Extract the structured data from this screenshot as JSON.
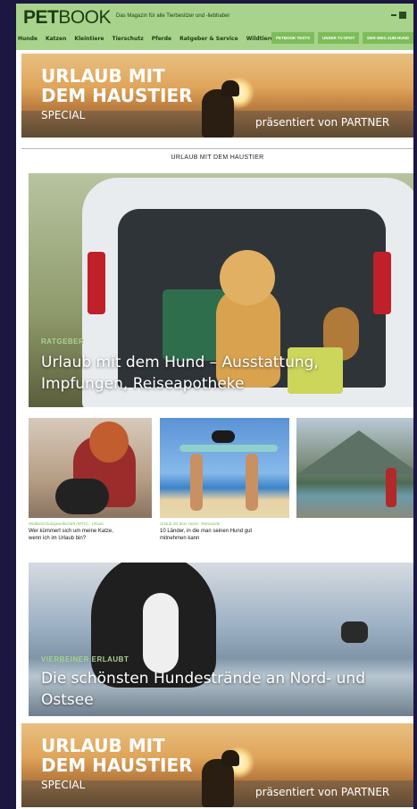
{
  "header": {
    "logo_bold": "PET",
    "logo_light": "BOOK",
    "tagline": "Das Magazin für alle Tierbesitzer und -liebhaber",
    "nav": [
      "Hunde",
      "Katzen",
      "Kleintiere",
      "Tierschutz",
      "Pferde",
      "Ratgeber & Service",
      "Wildtiere"
    ],
    "pills": [
      "PETBOOK TESTS",
      "UNSER TV-SPOT",
      "DER WEG ZUM HUND"
    ]
  },
  "banner_top": {
    "title_line1": "URLAUB MIT",
    "title_line2": "DEM HAUSTIER",
    "subtitle": "SPECIAL",
    "sponsor": "präsentiert von PARTNER"
  },
  "section": {
    "title": "URLAUB  MIT DEM HAUSTIER"
  },
  "hero": {
    "label": "RATGEBER",
    "title": "Urlaub mit dem Hund – Ausstattung, Impfungen, Reiseapotheke"
  },
  "teasers": [
    {
      "label": "Welttierschutzgesellschaft (WTG) · Urlaub",
      "title": "Wer kümmert sich um meine Katze, wenn ich im Urlaub bin?"
    },
    {
      "label": "Urlaub mit dem Hund · Reiseziele",
      "title": "10 Länder, in die man seinen Hund gut mitnehmen kann"
    },
    {
      "label": "",
      "title": ""
    }
  ],
  "beach": {
    "label": "VIERBEINER  ERLAUBT",
    "title": "Die schönsten Hundestrände an Nord- und Ostsee"
  },
  "banner_bottom": {
    "title_line1": "URLAUB MIT",
    "title_line2": "DEM HAUSTIER",
    "subtitle": "SPECIAL",
    "sponsor": "präsentiert von PARTNER"
  },
  "colors": {
    "header_green": "#a8d38c",
    "accent_green": "#7dbd59",
    "frame": "#1b1740"
  }
}
